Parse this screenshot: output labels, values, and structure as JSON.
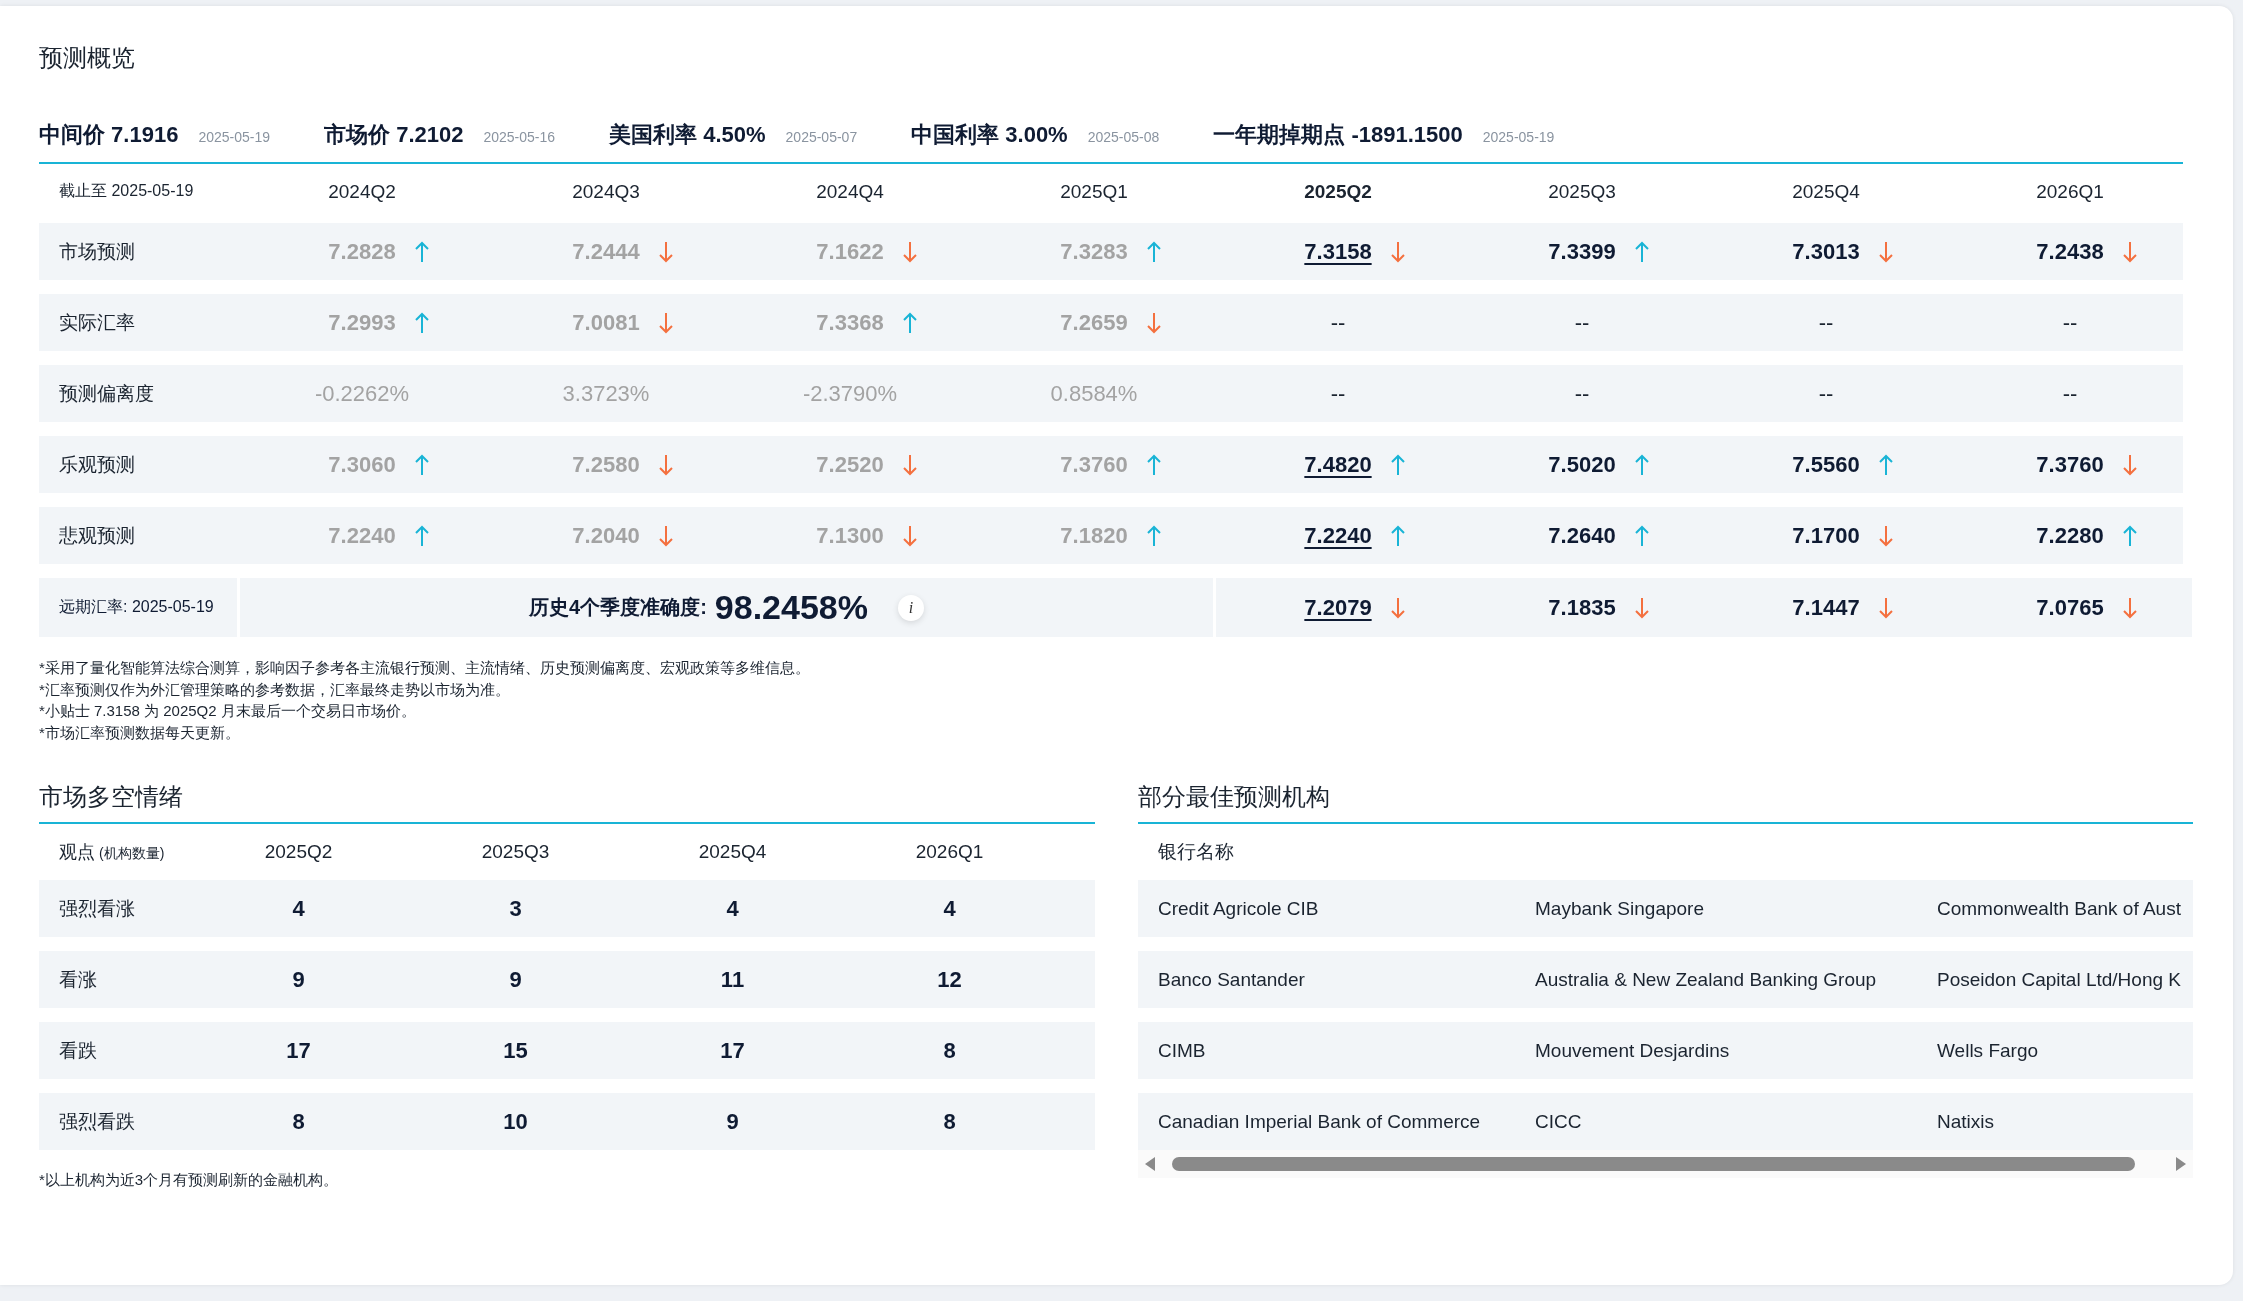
{
  "overview": {
    "title": "预测概览",
    "indicators": [
      {
        "label": "中间价 7.1916",
        "date": "2025-05-19"
      },
      {
        "label": "市场价 7.2102",
        "date": "2025-05-16"
      },
      {
        "label": "美国利率 4.50%",
        "date": "2025-05-07"
      },
      {
        "label": "中国利率 3.00%",
        "date": "2025-05-08"
      },
      {
        "label": "一年期掉期点 -1891.1500",
        "date": "2025-05-19"
      }
    ]
  },
  "forecast_table": {
    "corner": "截止至 2025-05-19",
    "columns": [
      {
        "label": "2024Q2",
        "past": true,
        "selected": false
      },
      {
        "label": "2024Q3",
        "past": true,
        "selected": false
      },
      {
        "label": "2024Q4",
        "past": true,
        "selected": false
      },
      {
        "label": "2025Q1",
        "past": true,
        "selected": false
      },
      {
        "label": "2025Q2",
        "past": false,
        "selected": true
      },
      {
        "label": "2025Q3",
        "past": false,
        "selected": false
      },
      {
        "label": "2025Q4",
        "past": false,
        "selected": false
      },
      {
        "label": "2026Q1",
        "past": false,
        "selected": false
      }
    ],
    "rows": [
      {
        "label": "市场预测",
        "cells": [
          {
            "value": "7.2828",
            "kind": "up"
          },
          {
            "value": "7.2444",
            "kind": "down"
          },
          {
            "value": "7.1622",
            "kind": "down"
          },
          {
            "value": "7.3283",
            "kind": "up"
          },
          {
            "value": "7.3158",
            "kind": "down"
          },
          {
            "value": "7.3399",
            "kind": "up"
          },
          {
            "value": "7.3013",
            "kind": "down"
          },
          {
            "value": "7.2438",
            "kind": "down"
          }
        ]
      },
      {
        "label": "实际汇率",
        "cells": [
          {
            "value": "7.2993",
            "kind": "up"
          },
          {
            "value": "7.0081",
            "kind": "down"
          },
          {
            "value": "7.3368",
            "kind": "up"
          },
          {
            "value": "7.2659",
            "kind": "down"
          },
          {
            "value": "--",
            "kind": "plain"
          },
          {
            "value": "--",
            "kind": "plain"
          },
          {
            "value": "--",
            "kind": "plain"
          },
          {
            "value": "--",
            "kind": "plain"
          }
        ]
      },
      {
        "label": "预测偏离度",
        "cells": [
          {
            "value": "-0.2262%",
            "kind": "plain"
          },
          {
            "value": "3.3723%",
            "kind": "plain"
          },
          {
            "value": "-2.3790%",
            "kind": "plain"
          },
          {
            "value": "0.8584%",
            "kind": "plain"
          },
          {
            "value": "--",
            "kind": "plain"
          },
          {
            "value": "--",
            "kind": "plain"
          },
          {
            "value": "--",
            "kind": "plain"
          },
          {
            "value": "--",
            "kind": "plain"
          }
        ]
      },
      {
        "label": "乐观预测",
        "cells": [
          {
            "value": "7.3060",
            "kind": "up"
          },
          {
            "value": "7.2580",
            "kind": "down"
          },
          {
            "value": "7.2520",
            "kind": "down"
          },
          {
            "value": "7.3760",
            "kind": "up"
          },
          {
            "value": "7.4820",
            "kind": "up"
          },
          {
            "value": "7.5020",
            "kind": "up"
          },
          {
            "value": "7.5560",
            "kind": "up"
          },
          {
            "value": "7.3760",
            "kind": "down"
          }
        ]
      },
      {
        "label": "悲观预测",
        "cells": [
          {
            "value": "7.2240",
            "kind": "up"
          },
          {
            "value": "7.2040",
            "kind": "down"
          },
          {
            "value": "7.1300",
            "kind": "down"
          },
          {
            "value": "7.1820",
            "kind": "up"
          },
          {
            "value": "7.2240",
            "kind": "up"
          },
          {
            "value": "7.2640",
            "kind": "up"
          },
          {
            "value": "7.1700",
            "kind": "down"
          },
          {
            "value": "7.2280",
            "kind": "up"
          }
        ]
      }
    ],
    "accuracy_row": {
      "label": "远期汇率: 2025-05-19",
      "accuracy_label": "历史4个季度准确度:",
      "accuracy_value": "98.2458%",
      "info_mark": "i",
      "cells": [
        {
          "value": "7.2079",
          "kind": "down"
        },
        {
          "value": "7.1835",
          "kind": "down"
        },
        {
          "value": "7.1447",
          "kind": "down"
        },
        {
          "value": "7.0765",
          "kind": "down"
        }
      ]
    }
  },
  "notes": [
    "*采用了量化智能算法综合测算，影响因子参考各主流银行预测、主流情绪、历史预测偏离度、宏观政策等多维信息。",
    "*汇率预测仅作为外汇管理策略的参考数据，汇率最终走势以市场为准。",
    "*小贴士 7.3158 为 2025Q2 月末最后一个交易日市场价。",
    "*市场汇率预测数据每天更新。"
  ],
  "sentiment": {
    "title": "市场多空情绪",
    "header_label": "观点",
    "header_note": "(机构数量)",
    "columns": [
      "2025Q2",
      "2025Q3",
      "2025Q4",
      "2026Q1"
    ],
    "rows": [
      {
        "label": "强烈看涨",
        "values": [
          "4",
          "3",
          "4",
          "4"
        ]
      },
      {
        "label": "看涨",
        "values": [
          "9",
          "9",
          "11",
          "12"
        ]
      },
      {
        "label": "看跌",
        "values": [
          "17",
          "15",
          "17",
          "8"
        ]
      },
      {
        "label": "强烈看跌",
        "values": [
          "8",
          "10",
          "9",
          "8"
        ]
      }
    ],
    "note": "*以上机构为近3个月有预测刷新的金融机构。"
  },
  "institutions": {
    "title": "部分最佳预测机构",
    "header": "银行名称",
    "rows": [
      [
        "Credit Agricole CIB",
        "Maybank Singapore",
        "Commonwealth Bank of Aust"
      ],
      [
        "Banco Santander",
        "Australia & New Zealand Banking Group",
        "Poseidon Capital Ltd/Hong K"
      ],
      [
        "CIMB",
        "Mouvement Desjardins",
        "Wells Fargo"
      ],
      [
        "Canadian Imperial Bank of Commerce",
        "CICC",
        "Natixis"
      ]
    ]
  }
}
